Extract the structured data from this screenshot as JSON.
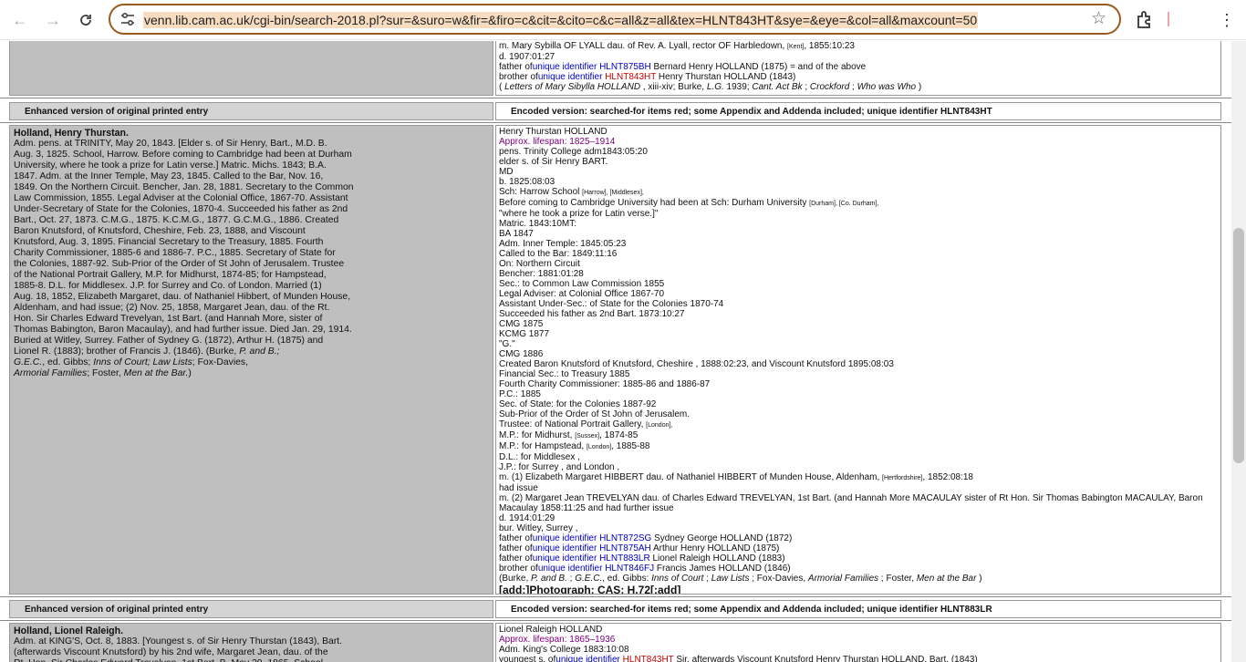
{
  "browser": {
    "url": "venn.lib.cam.ac.uk/cgi-bin/search-2018.pl?sur=&suro=w&fir=&firo=c&cit=&cito=c&c=all&z=all&tex=HLNT843HT&sye=&eye=&col=all&maxcount=50",
    "icons": [
      "back-icon",
      "forward-icon",
      "reload-icon",
      "site-info-icon",
      "star-icon",
      "extensions-icon",
      "menu-icon"
    ]
  },
  "top_entry": {
    "lines": {
      "l1_a": "m. Mary Sybilla OF LYALL dau. of Rev. A. Lyall, rector OF Harbledown, ",
      "l1_b": "[Kent]",
      "l1_c": ", 1855:10:23",
      "l2": "d. 1907:01:27",
      "l3_a": "father of",
      "l3_b": "unique identifier HLNT875BH",
      "l3_c": " Bernard Henry HOLLAND (1875) = and of the above",
      "l4_a": "brother of",
      "l4_b": "unique identifier ",
      "l4_c": "HLNT843HT",
      "l4_d": " Henry Thurstan HOLLAND (1843)",
      "l5_a": "( ",
      "l5_b": "Letters of Mary Sibylla HOLLAND",
      "l5_c": " , xiii-xiv; Burke, ",
      "l5_d": "L.G.",
      "l5_e": " 1939; ",
      "l5_f": "Cant. Act Bk",
      "l5_g": " ; ",
      "l5_h": "Crockford",
      "l5_i": " ; ",
      "l5_j": "Who was Who",
      "l5_k": " )"
    }
  },
  "entry1": {
    "header_left": "Enhanced version of original printed entry",
    "header_right": "Encoded version: searched-for items red; some Appendix and Addenda included; unique identifier HLNT843HT",
    "left": {
      "name": "Holland, Henry Thurstan.",
      "text_lines": [
        "Adm. pens. at TRINITY, May 20, 1843. [Elder s. of Sir Henry, Bart., M.D. B.",
        "Aug. 3, 1825. School, Harrow. Before coming to Cambridge had been at Durham",
        "University, where he took a prize for Latin verse.] Matric. Michs. 1843; B.A.",
        "1847. Adm. at the Inner Temple, May 23, 1845. Called to the Bar, Nov. 16,",
        "1849. On the Northern Circuit. Bencher, Jan. 28, 1881. Secretary to the Common",
        "Law Commission, 1855. Legal Adviser at the Colonial Office, 1867-70. Assistant",
        "Under-Secretary of State for the Colonies, 1870-4. Succeeded his father as 2nd",
        "Bart., Oct. 27, 1873. C.M.G., 1875. K.C.M.G., 1877. G.C.M.G., 1886. Created",
        "Baron Knutsford, of Knutsford, Cheshire, Feb. 23, 1888, and Viscount",
        "Knutsford, Aug. 3, 1895. Financial Secretary to the Treasury, 1885. Fourth",
        "Charity Commissioner, 1885-6 and 1886-7. P.C., 1885. Secretary of State for",
        "the Colonies, 1887-92. Sub-Prior of the Order of St John of Jerusalem. Trustee",
        "of the National Portrait Gallery, M.P. for Midhurst, 1874-85; for Hampstead,",
        "1885-8. D.L. for Middlesex. J.P. for Surrey and Co. of London. Married (1)",
        "Aug. 18, 1852, Elizabeth Margaret, dau. of Nathaniel Hibbert, of Munden House,",
        "Aldenham, and had issue; (2) Nov. 25, 1858, Margaret Jean, dau. of the Rt.",
        "Hon. Sir Charles Edward Trevelyan, 1st Bart. (and Hannah More, sister of",
        "Thomas Babington, Baron Macaulay), and had further issue. Died Jan. 29, 1914.",
        "Buried at Witley, Surrey. Father of Sydney G. (1872), Arthur H. (1875) and",
        "Lionel R. (1883); brother of Francis J. (1846). (Burke, "
      ],
      "last_line_italic": "P. and B.;",
      "tail_1": "G.E.C.",
      "tail_2": ", ed. Gibbs; ",
      "tail_3": "Inns of Court; Law Lists",
      "tail_4": "; Fox-Davies,",
      "tail_5": "Armorial Families",
      "tail_6": "; Foster, ",
      "tail_7": "Men at the Bar.",
      "tail_8": ")"
    },
    "right": {
      "name": "Henry Thurstan HOLLAND",
      "lifespan": "Approx. lifespan: 1825–1914",
      "lines_a": [
        "pens. Trinity College adm1843:05:20",
        "elder s. of Sir Henry BART.",
        "MD",
        "b. 1825:08:03"
      ],
      "school_a": "Sch: Harrow School ",
      "school_b": "[Harrow], [Middlesex],",
      "durham_a": "Before coming to Cambridge University had been at Sch: Durham University ",
      "durham_b": "[Durham], [Co. Durham],",
      "lines_b": [
        "\"where he took a prize for Latin verse.]\"",
        "Matric. 1843:10MT:",
        "BA 1847",
        "Adm. Inner Temple: 1845:05:23",
        "Called to the Bar: 1849:11:16",
        "On: Northern Circuit",
        "Bencher: 1881:01:28",
        "Sec.: to Common Law Commission 1855",
        "Legal Adviser: at Colonial Office 1867-70",
        "Assistant Under-Sec.: of State for the Colonies 1870-74",
        "Succeeded his father as 2nd Bart. 1873:10:27",
        "CMG 1875",
        "KCMG 1877",
        "\"G.\"",
        "CMG 1886",
        "Created Baron Knutsford of Knutsford, Cheshire , 1888:02:23, and Viscount Knutsford 1895:08:03",
        "Financial Sec.: to Treasury 1885",
        "Fourth Charity Commissioner: 1885-86 and 1886-87",
        "P.C.: 1885",
        "Sec. of State: for the Colonies 1887-92",
        "Sub-Prior of the Order of St John of Jerusalem."
      ],
      "trustee_a": "Trustee: of National Portrait Gallery, ",
      "trustee_b": "[London],",
      "mp1_a": "M.P.: for Midhurst, ",
      "mp1_b": "[Sussex]",
      "mp1_c": ", 1874-85",
      "mp2_a": "M.P.: for Hampstead, ",
      "mp2_b": "[London]",
      "mp2_c": ", 1885-88",
      "dl": "D.L.: for Middlesex ,",
      "jp": "J.P.: for Surrey , and London ,",
      "m1_a": "m. (1) Elizabeth Margaret HIBBERT dau. of Nathaniel HIBBERT of Munden House, Aldenham, ",
      "m1_b": "[Hertfordshire]",
      "m1_c": ", 1852:08:18",
      "issue": "had issue",
      "m2_1": "m. (2) Margaret Jean TREVELYAN dau. of Charles Edward TREVELYAN, 1st Bart. (and Hannah More MACAULAY sister of Rt Hon. Sir Thomas Babington MACAULAY, Baron",
      "m2_2": "Macaulay 1858:11:25 and had further issue",
      "died": "d. 1914:01:29",
      "bur": "bur. Witley, Surrey ,",
      "rel": [
        {
          "pre": "father of",
          "uid": "unique identifier HLNT872SG",
          "post": " Sydney George HOLLAND (1872)"
        },
        {
          "pre": "father of",
          "uid": "unique identifier HLNT875AH",
          "post": " Arthur Henry HOLLAND (1875)"
        },
        {
          "pre": "father of",
          "uid": "unique identifier HLNT883LR",
          "post": " Lionel Raleigh HOLLAND (1883)"
        },
        {
          "pre": "brother of",
          "uid": "unique identifier HLNT846FJ",
          "post": " Francis James HOLLAND (1846)"
        }
      ],
      "src_1": "(Burke, ",
      "src_2": "P. and B.",
      "src_3": " ; ",
      "src_4": "G.E.C.",
      "src_5": ", ed. Gibbs: ",
      "src_6": "Inns of Court",
      "src_7": " ; ",
      "src_8": "Law Lists",
      "src_9": " ; Fox-Davies, ",
      "src_10": "Armorial Families",
      "src_11": " ; Foster, ",
      "src_12": "Men at the Bar",
      "src_13": " )",
      "photo": "[add:]Photograph: CAS: H.72[:add]"
    }
  },
  "entry2": {
    "header_left": "Enhanced version of original printed entry",
    "header_right": "Encoded version: searched-for items red; some Appendix and Addenda included; unique identifier HLNT883LR",
    "left": {
      "name": "Holland, Lionel Raleigh.",
      "lines": [
        "Adm. at KING'S, Oct. 8, 1883. [Youngest s. of Sir Henry Thurstan (1843), Bart.",
        "(afterwards Viscount Knutsford) by his 2nd wife, Margaret Jean, dau. of the",
        "Rt. Hon. Sir Charles Edward Trevelyan, 1st Bart. B. May 29, 1865. School,"
      ]
    },
    "right": {
      "name": "Lionel Raleigh HOLLAND",
      "lifespan": "Approx. lifespan: 1865–1936",
      "adm": "Adm. King's College 1883:10:08",
      "y_a": "youngest s. of",
      "y_b": "unique identifier ",
      "y_c": "HLNT843HT",
      "y_d": " Sir, afterwards Viscount Knutsford Henry Thurstan HOLLAND, Bart. (1843)"
    }
  }
}
